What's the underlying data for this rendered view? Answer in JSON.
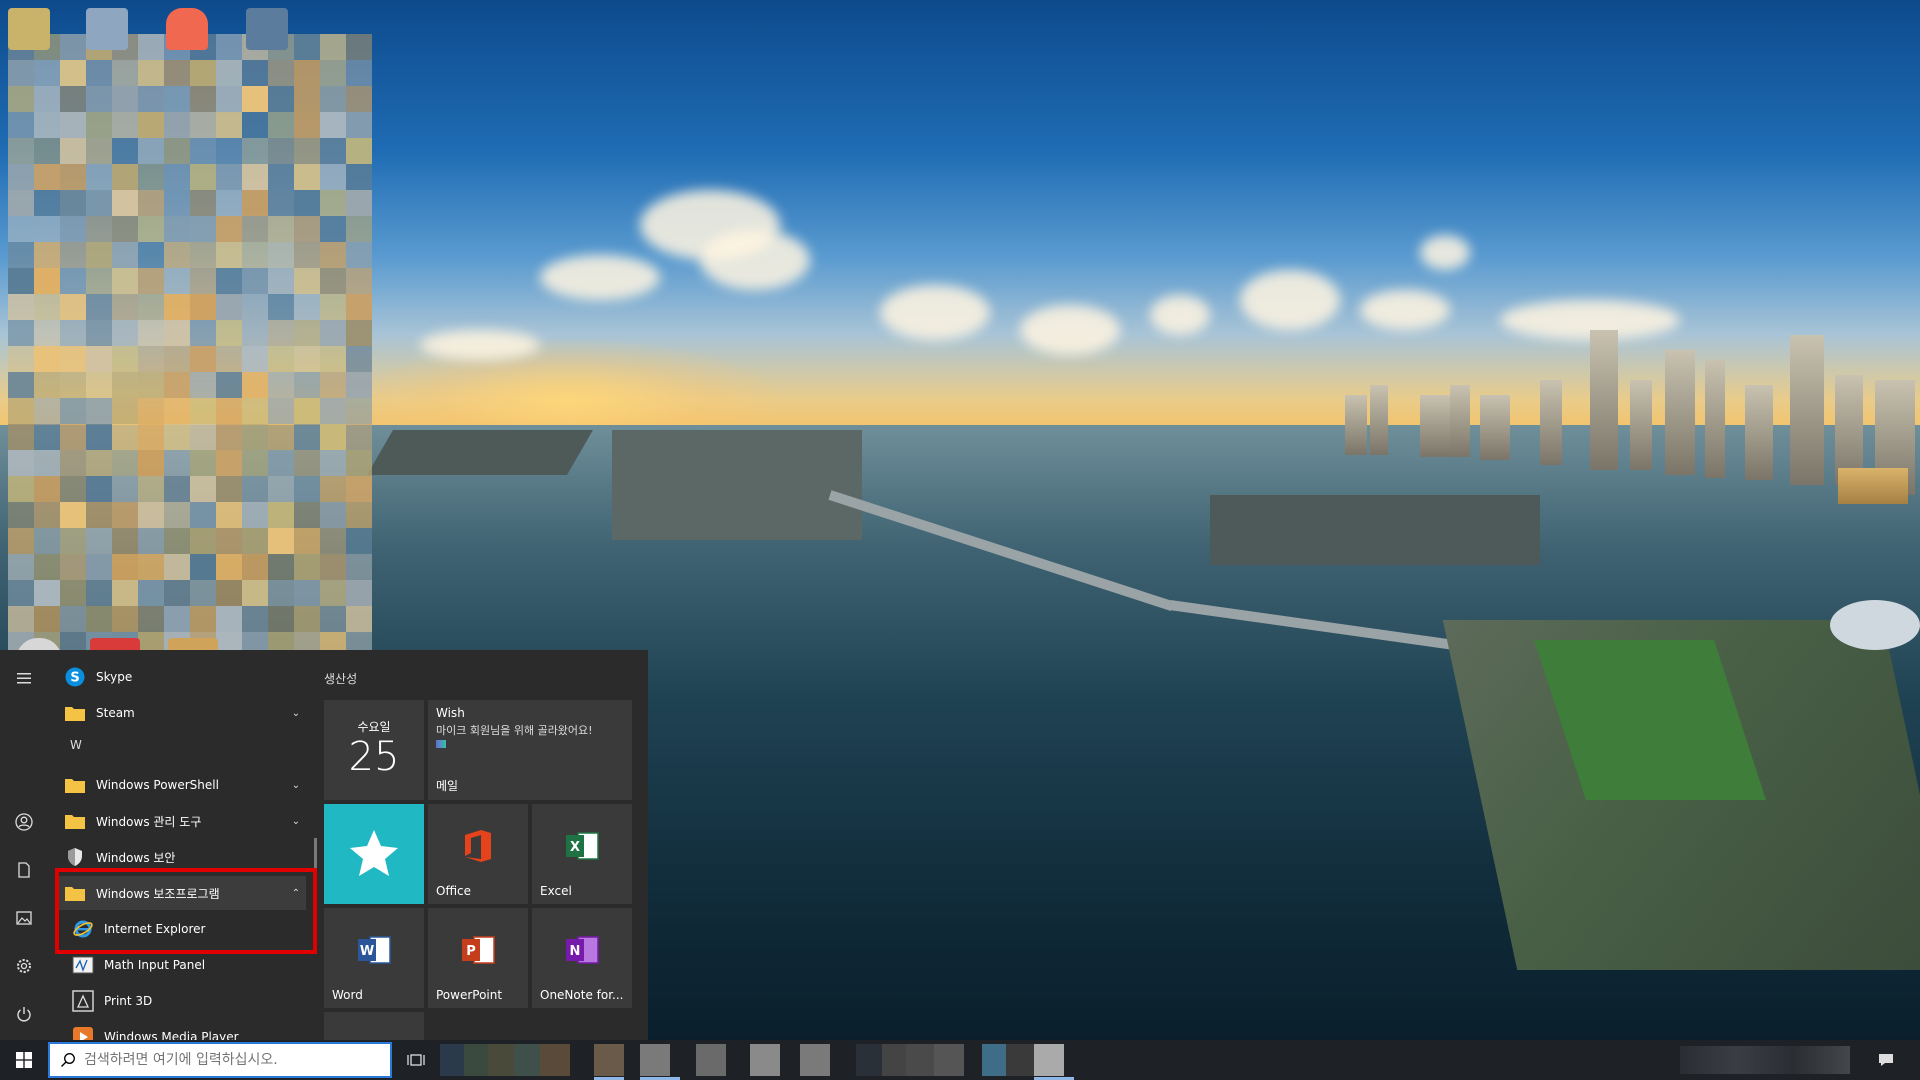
{
  "start_menu": {
    "apps": [
      {
        "label": "Skype",
        "icon": "skype-icon",
        "chevron": ""
      },
      {
        "label": "Steam",
        "icon": "folder-icon",
        "chevron": "⌄"
      },
      {
        "label": "Windows PowerShell",
        "icon": "folder-icon",
        "chevron": "⌄"
      },
      {
        "label": "Windows 관리 도구",
        "icon": "folder-icon",
        "chevron": "⌄"
      },
      {
        "label": "Windows 보안",
        "icon": "shield-icon",
        "chevron": ""
      },
      {
        "label": "Windows 보조프로그램",
        "icon": "folder-icon",
        "chevron": "⌃"
      },
      {
        "label": "Internet Explorer",
        "icon": "internet-explorer-icon",
        "chevron": ""
      },
      {
        "label": "Math Input Panel",
        "icon": "math-input-icon",
        "chevron": ""
      },
      {
        "label": "Print 3D",
        "icon": "print-3d-icon",
        "chevron": ""
      },
      {
        "label": "Windows Media Player",
        "icon": "media-player-icon",
        "chevron": ""
      }
    ],
    "section_letter": "W",
    "tile_group_title": "생산성",
    "tiles": {
      "calendar": {
        "day_name": "수요일",
        "day_number": "25"
      },
      "mail": {
        "title": "Wish",
        "message": "마이크 회원님을 위해 골라왔어요!",
        "label": "메일"
      },
      "office": {
        "label": "Office"
      },
      "excel": {
        "label": "Excel"
      },
      "word": {
        "label": "Word"
      },
      "powerpoint": {
        "label": "PowerPoint"
      },
      "onenote": {
        "label": "OneNote for..."
      }
    }
  },
  "taskbar": {
    "search_placeholder": "검색하려면 여기에 입력하십시오."
  },
  "colors": {
    "highlight": "#e00000",
    "accent_tile": "#1fb8c3",
    "search_border": "#2b79d8"
  }
}
